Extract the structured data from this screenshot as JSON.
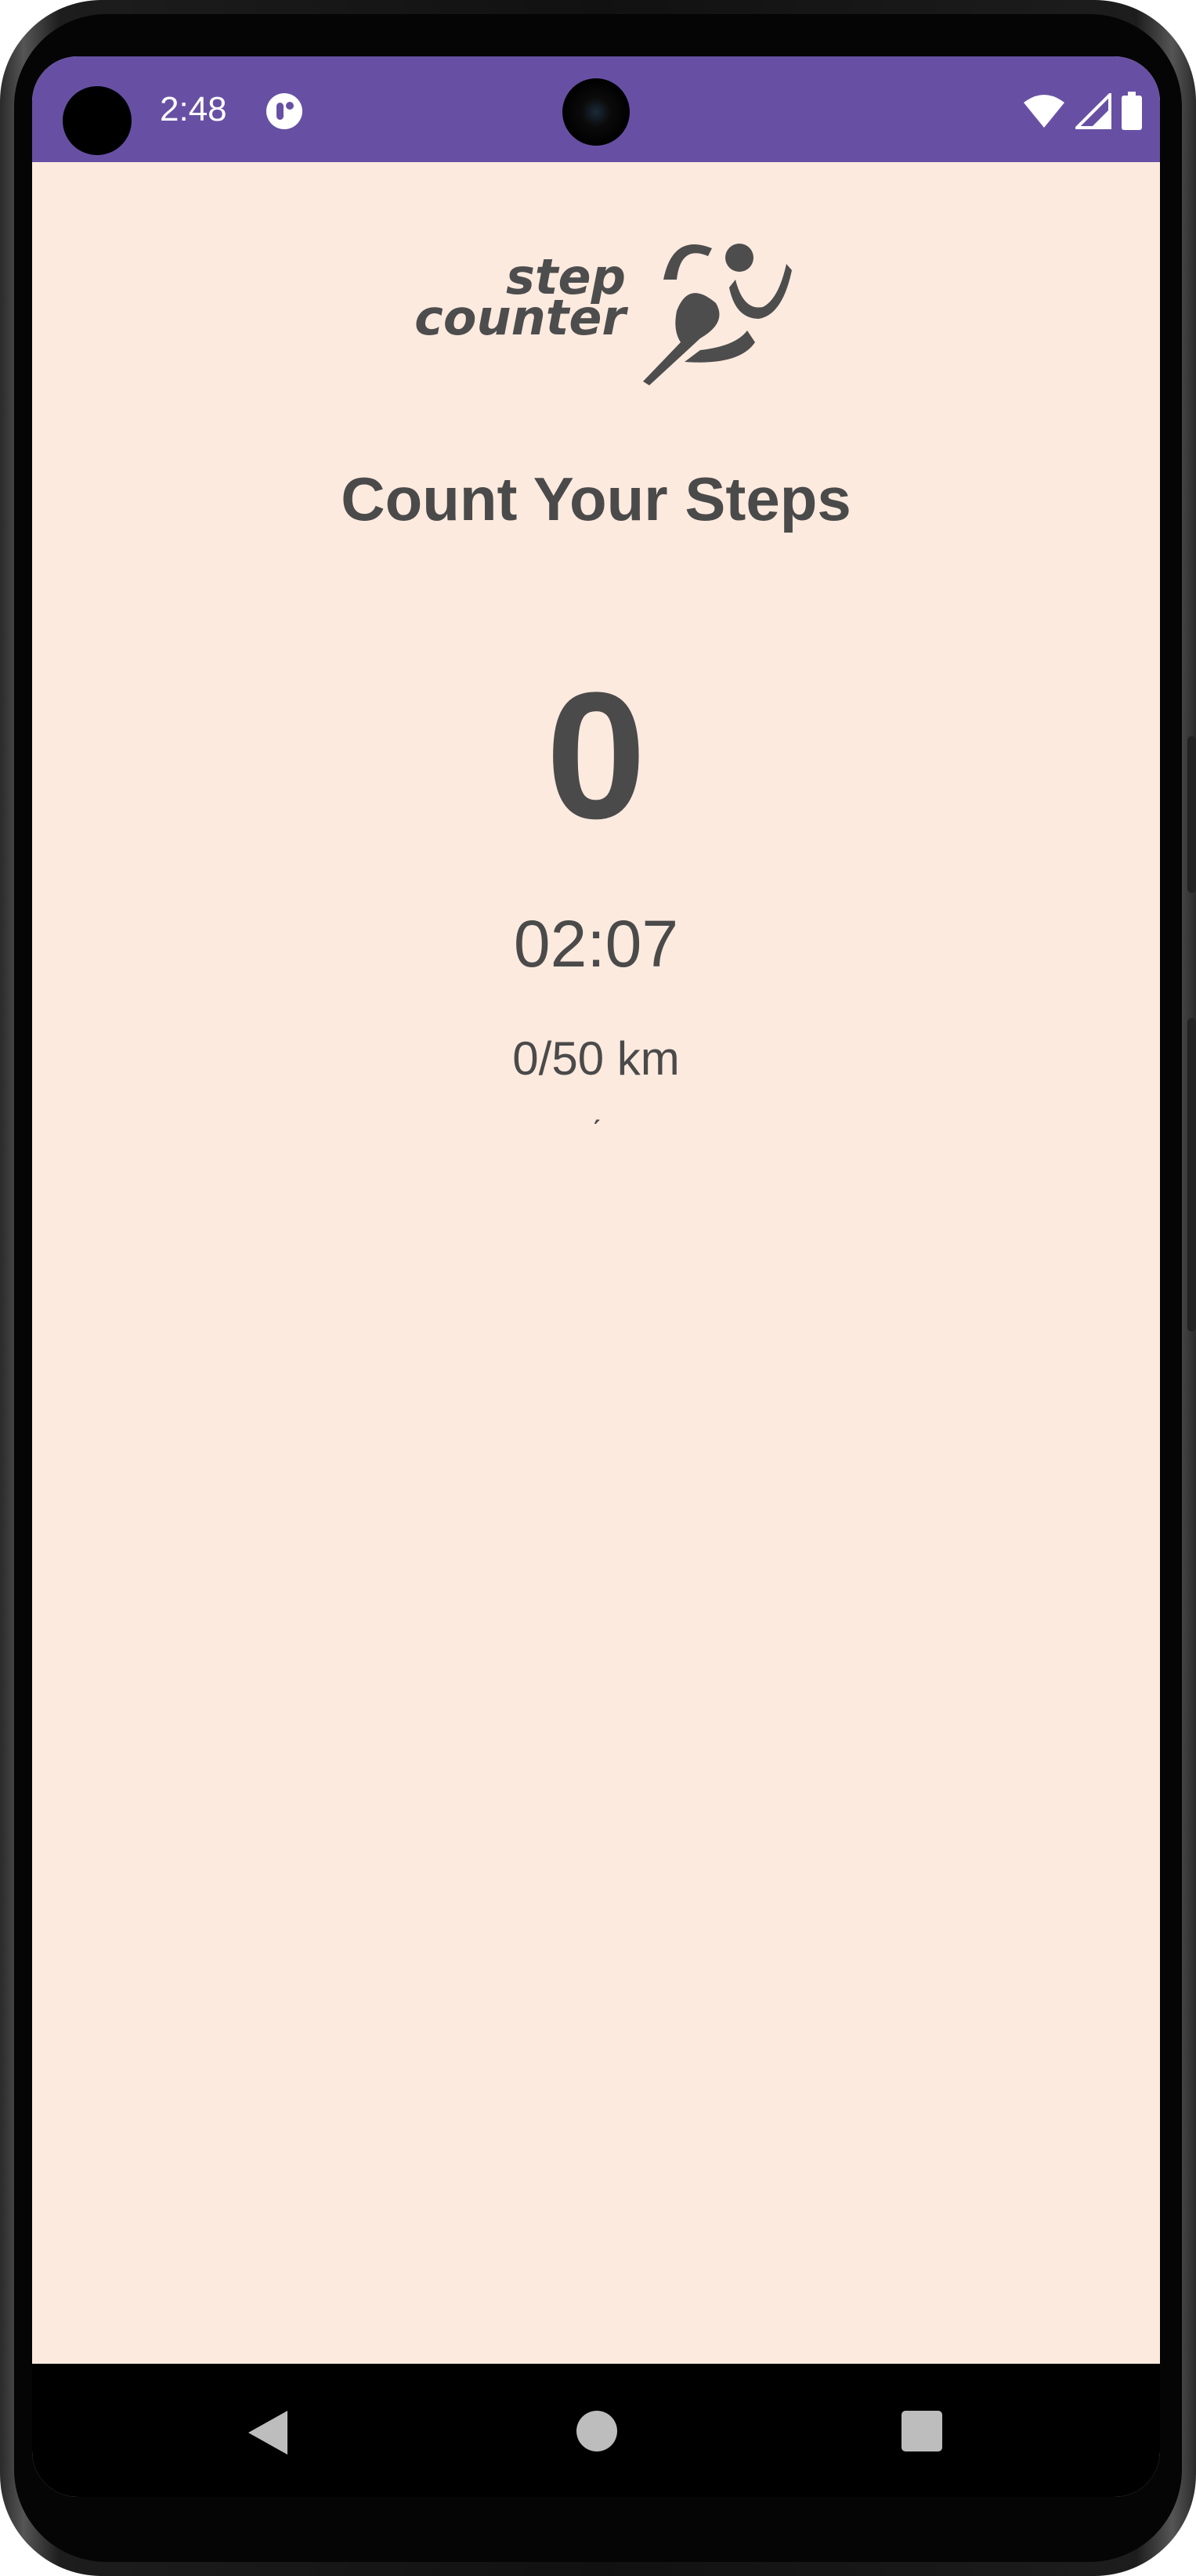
{
  "status_bar": {
    "time": "2:48",
    "color": "#6750a4",
    "icons": [
      "app-notification-icon",
      "wifi-icon",
      "signal-icon",
      "battery-icon"
    ]
  },
  "logo": {
    "line1": "step",
    "line2": "counter",
    "icon": "runner-icon"
  },
  "main": {
    "title": "Count Your Steps",
    "step_count": "0",
    "timer": "02:07",
    "distance": "0/50 km",
    "mark": "ˏ"
  },
  "theme": {
    "background": "#fdeadf",
    "text": "#4a4a4a"
  },
  "nav_bar": {
    "buttons": [
      "back-icon",
      "home-icon",
      "recents-icon"
    ]
  }
}
